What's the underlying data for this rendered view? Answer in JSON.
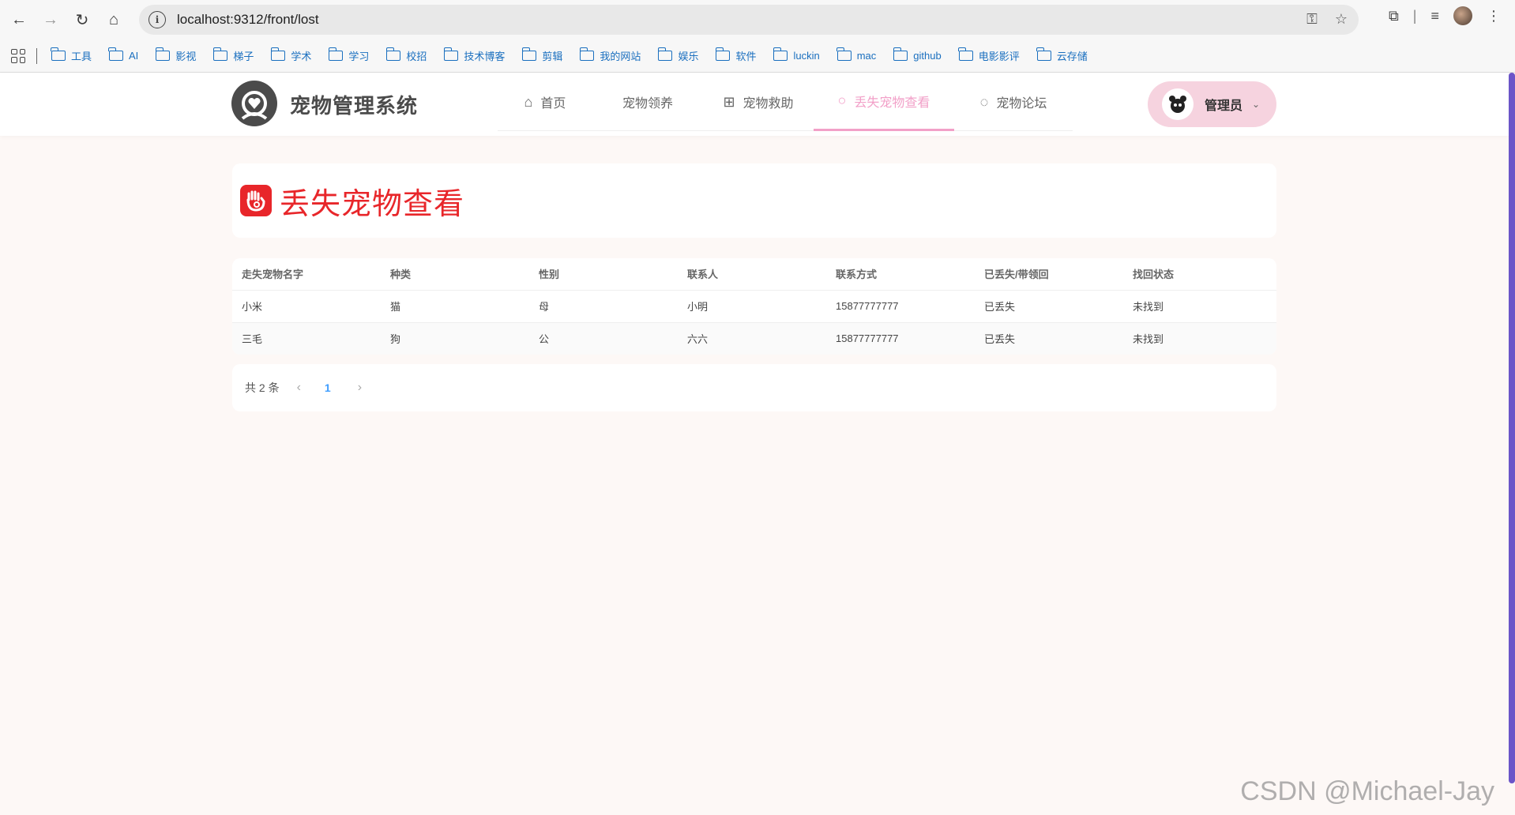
{
  "browser": {
    "url": "localhost:9312/front/lost",
    "bookmarks": [
      "工具",
      "AI",
      "影视",
      "梯子",
      "学术",
      "学习",
      "校招",
      "技术博客",
      "剪辑",
      "我的网站",
      "娱乐",
      "软件",
      "luckin",
      "mac",
      "github",
      "电影影评",
      "云存储"
    ]
  },
  "header": {
    "logo_text": "宠物管理系统",
    "nav": [
      {
        "label": "首页",
        "icon": "home-icon"
      },
      {
        "label": "宠物领养",
        "icon": ""
      },
      {
        "label": "宠物救助",
        "icon": "medical-box-icon"
      },
      {
        "label": "丢失宠物查看",
        "icon": "search-icon"
      },
      {
        "label": "宠物论坛",
        "icon": "chat-icon"
      }
    ],
    "user": "管理员"
  },
  "page": {
    "title": "丢失宠物查看"
  },
  "table": {
    "columns": [
      "走失宠物名字",
      "种类",
      "性别",
      "联系人",
      "联系方式",
      "已丢失/带领回",
      "找回状态"
    ],
    "rows": [
      [
        "小米",
        "猫",
        "母",
        "小明",
        "15877777777",
        "已丢失",
        "未找到"
      ],
      [
        "三毛",
        "狗",
        "公",
        "六六",
        "15877777777",
        "已丢失",
        "未找到"
      ]
    ]
  },
  "pagination": {
    "total": "共 2 条",
    "current": "1"
  },
  "watermark": "CSDN @Michael-Jay",
  "colors": {
    "accent_pink": "#f2a0c8",
    "title_red": "#e8262a",
    "page_link": "#409eff"
  }
}
